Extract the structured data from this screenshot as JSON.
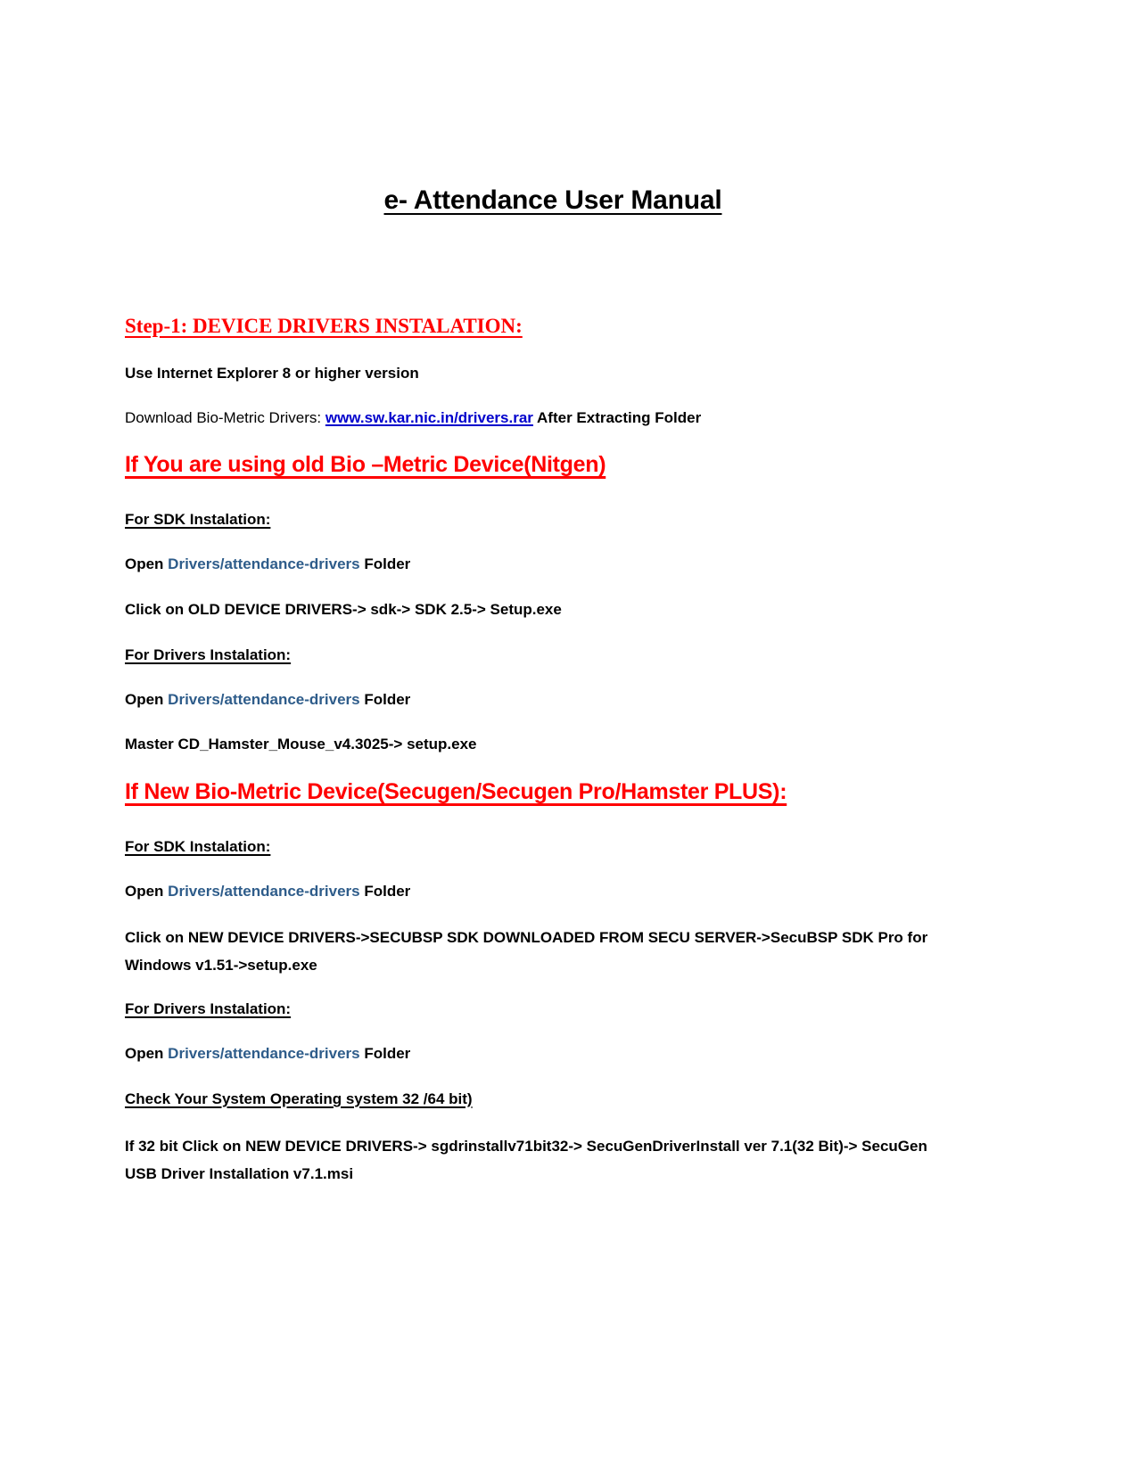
{
  "document": {
    "title": "e- Attendance User Manual",
    "colors": {
      "red_heading": "#FF0000",
      "link_blue": "#0000CC",
      "path_blue": "#2E5C8A",
      "body_black": "#000000",
      "page_background": "#FFFFFF"
    },
    "step1": {
      "heading": "Step-1: DEVICE DRIVERS INSTALATION:",
      "browser_note": "Use Internet Explorer 8 or higher version",
      "download_prefix": "Download Bio-Metric  Drivers: ",
      "download_url": "www.sw.kar.nic.in/drivers.rar",
      "download_suffix": "  After Extracting Folder"
    },
    "old_device": {
      "heading": "If You are using old Bio –Metric Device(Nitgen)",
      "sdk_label": "For SDK Instalation:",
      "open_prefix": "Open ",
      "open_path": "Drivers/attendance-drivers",
      "open_suffix": " Folder",
      "sdk_steps": "Click on OLD DEVICE DRIVERS-> sdk-> SDK 2.5-> Setup.exe",
      "drivers_label": " For Drivers  Instalation:",
      "drivers_steps": " Master CD_Hamster_Mouse_v4.3025-> setup.exe"
    },
    "new_device": {
      "heading": "If New Bio-Metric Device(Secugen/Secugen Pro/Hamster PLUS):",
      "sdk_label": "For SDK Instalation:",
      "open_prefix": "Open ",
      "open_path": "Drivers/attendance-drivers",
      "open_suffix": " Folder",
      "sdk_steps": "Click on NEW DEVICE DRIVERS->SECUBSP SDK DOWNLOADED FROM SECU SERVER->SecuBSP SDK Pro for Windows v1.51->setup.exe",
      "drivers_label": "For Drivers  Instalation:",
      "os_check_label": " Check Your System Operating system 32 /64 bit)",
      "bit32_steps": "If 32 bit Click on NEW DEVICE DRIVERS-> sgdrinstallv71bit32-> SecuGenDriverInstall ver 7.1(32 Bit)-> SecuGen USB Driver Installation v7.1.msi"
    }
  }
}
